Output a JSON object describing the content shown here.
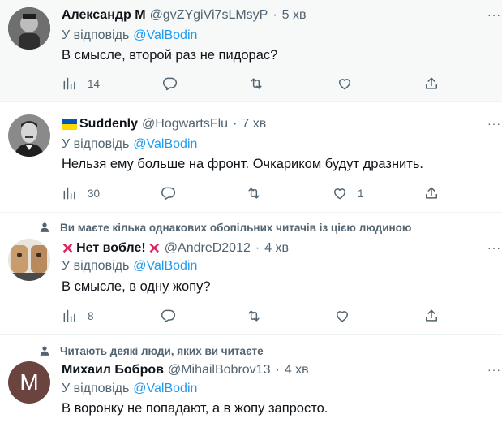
{
  "tweets": [
    {
      "name": "Александр М",
      "handle": "@gvZYgiVi7sLMsyP",
      "time": "5 хв",
      "reply_prefix": "У відповідь",
      "reply_to": "@ValBodin",
      "text": "В смысле, второй раз не пидорас?",
      "counts": {
        "replies": "14",
        "retweets": "",
        "likes": ""
      }
    },
    {
      "name": "Suddenly",
      "handle": "@HogwartsFlu",
      "time": "7 хв",
      "reply_prefix": "У відповідь",
      "reply_to": "@ValBodin",
      "text": "Нельзя ему больше на фронт. Очкариком будут дразнить.",
      "counts": {
        "replies": "30",
        "retweets": "",
        "likes": "1"
      }
    },
    {
      "social_context": "Ви маєте кілька однакових обопільних читачів із цією людиною",
      "name": "Нет вобле!",
      "handle": "@AndreD2012",
      "time": "4 хв",
      "reply_prefix": "У відповідь",
      "reply_to": "@ValBodin",
      "text": "В смысле, в одну жопу?",
      "counts": {
        "replies": "8",
        "retweets": "",
        "likes": ""
      }
    },
    {
      "social_context": "Читають деякі люди, яких ви читаєте",
      "name": "Михаил Бобров",
      "handle": "@MihailBobrov13",
      "time": "4 хв",
      "avatar_letter": "M",
      "reply_prefix": "У відповідь",
      "reply_to": "@ValBodin",
      "text": "В воронку не попадают, а в жопу запросто."
    }
  ],
  "icons": [
    "more-icon",
    "analytics-icon",
    "reply-icon",
    "retweet-icon",
    "like-icon",
    "share-icon",
    "person-icon",
    "ukraine-flag-icon",
    "cross-mark-icon"
  ],
  "colors": {
    "link": "#1d9bf0",
    "secondary": "#536471",
    "hover_bg": "#f7f9f9",
    "avatar_brown": "#6b4440"
  }
}
